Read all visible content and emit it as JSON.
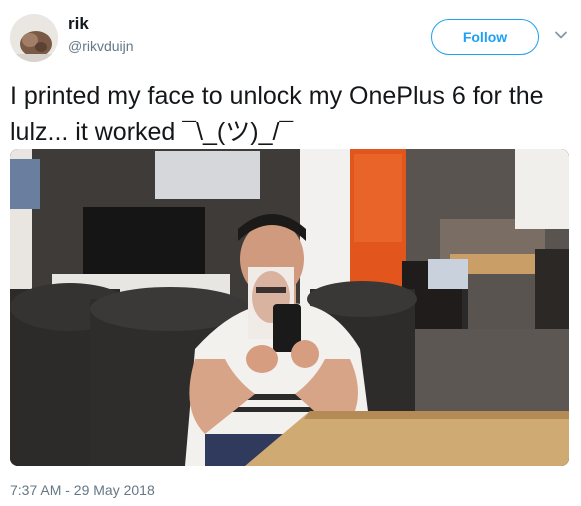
{
  "user": {
    "name": "rik",
    "handle": "@rikvduijn"
  },
  "actions": {
    "follow_label": "Follow"
  },
  "tweet": {
    "text": "I printed my face to unlock my OnePlus 6 for the lulz... it worked ¯\\_(ツ)_/¯",
    "timestamp": "7:37 AM - 29 May 2018"
  },
  "icons": {
    "more": "chevron-down-icon"
  },
  "colors": {
    "accent": "#1da1f2",
    "secondary_text": "#657786"
  }
}
